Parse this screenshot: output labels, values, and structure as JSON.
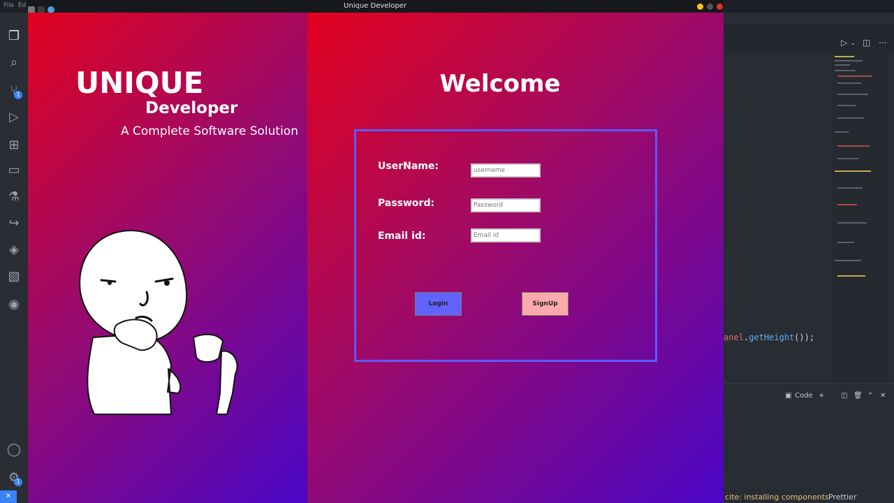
{
  "editor": {
    "menu": [
      "File",
      "Edi"
    ],
    "activity_badges": [
      "1",
      "1"
    ],
    "code_line": {
      "prefix": "anel",
      "method": "getHeight",
      "suffix": "());"
    },
    "panel": {
      "code_label": "Code"
    },
    "status": {
      "message": "cite: installing components",
      "prettier": "Prettier"
    }
  },
  "window": {
    "title": "Unique Developer"
  },
  "branding": {
    "title": "UNIQUE",
    "subtitle": "Developer",
    "tagline": "A Complete Software Solution"
  },
  "welcome": {
    "heading": "Welcome"
  },
  "form": {
    "username": {
      "label": "UserName:",
      "placeholder": "username"
    },
    "password": {
      "label": "Password:",
      "placeholder": "Password"
    },
    "email": {
      "label": "Email id:",
      "placeholder": "Email id"
    },
    "login_label": "Login",
    "signup_label": "SignUp"
  },
  "colors": {
    "login_button": "#6262ff",
    "signup_button": "#ffaaaa",
    "form_border": "#5b5bff"
  }
}
